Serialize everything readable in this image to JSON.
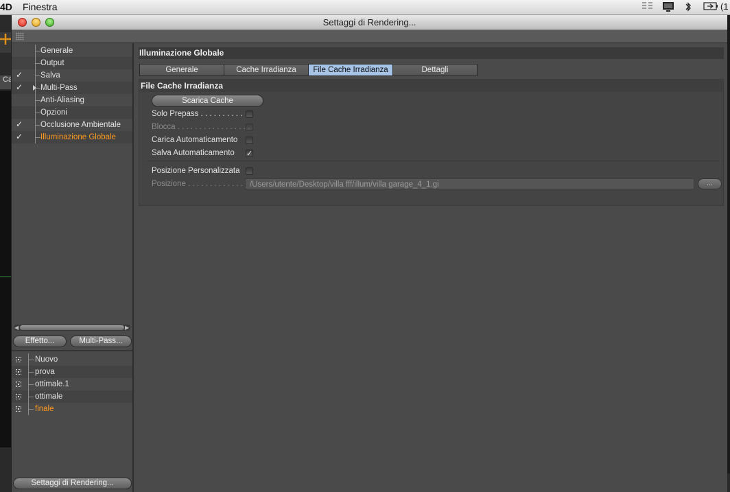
{
  "menubar": {
    "app_name": "4D",
    "menu_window": "Finestra",
    "battery_text": "(1"
  },
  "background_app": {
    "left_tab_text": "Ca"
  },
  "window": {
    "title": "Settaggi di Rendering...",
    "accent_color": "#ff9a1e",
    "tab_active_color": "#a7c3e6"
  },
  "tree": {
    "items": [
      {
        "label": "Generale",
        "checked": false,
        "selected": false,
        "expandable": false
      },
      {
        "label": "Output",
        "checked": false,
        "selected": false,
        "expandable": false
      },
      {
        "label": "Salva",
        "checked": true,
        "selected": false,
        "expandable": false
      },
      {
        "label": "Multi-Pass",
        "checked": true,
        "selected": false,
        "expandable": true
      },
      {
        "label": "Anti-Aliasing",
        "checked": false,
        "selected": false,
        "expandable": false
      },
      {
        "label": "Opzioni",
        "checked": false,
        "selected": false,
        "expandable": false
      },
      {
        "label": "Occlusione Ambientale",
        "checked": true,
        "selected": false,
        "expandable": false
      },
      {
        "label": "Illuminazione Globale",
        "checked": true,
        "selected": true,
        "expandable": false
      }
    ]
  },
  "left_buttons": {
    "effect": "Effetto...",
    "multipass": "Multi-Pass..."
  },
  "presets": {
    "items": [
      {
        "label": "Nuovo",
        "selected": false
      },
      {
        "label": "prova",
        "selected": false
      },
      {
        "label": "ottimale.1",
        "selected": false
      },
      {
        "label": "ottimale",
        "selected": false
      },
      {
        "label": "finale",
        "selected": true
      }
    ]
  },
  "footer_button": "Settaggi di Rendering...",
  "main": {
    "section_title": "Illuminazione Globale",
    "tabs": [
      {
        "label": "Generale",
        "active": false
      },
      {
        "label": "Cache Irradianza",
        "active": false
      },
      {
        "label": "File Cache Irradianza",
        "active": true
      },
      {
        "label": "Dettagli",
        "active": false
      }
    ],
    "group_title": "File Cache Irradianza",
    "clear_cache_button": "Scarica Cache",
    "options": [
      {
        "label": "Solo Prepass",
        "dots": " . . . . . . . . . .",
        "checked": false,
        "disabled": false
      },
      {
        "label": "Blocca",
        "dots": " . . . . . . . . . . . . . . . . .",
        "checked": false,
        "disabled": true
      },
      {
        "label": "Carica Automaticamento",
        "dots": "",
        "checked": false,
        "disabled": false
      },
      {
        "label": "Salva Automaticamento",
        "dots": "",
        "checked": true,
        "disabled": false
      }
    ],
    "custom_position": {
      "label": "Posizione Personalizzata",
      "checked": false
    },
    "position": {
      "label": "Posizione",
      "dots": " . . . . . . . . . . . . . .",
      "value": "/Users/utente/Desktop/villa fff/illum/villa garage_4_1.gi",
      "browse_label": "..."
    }
  }
}
